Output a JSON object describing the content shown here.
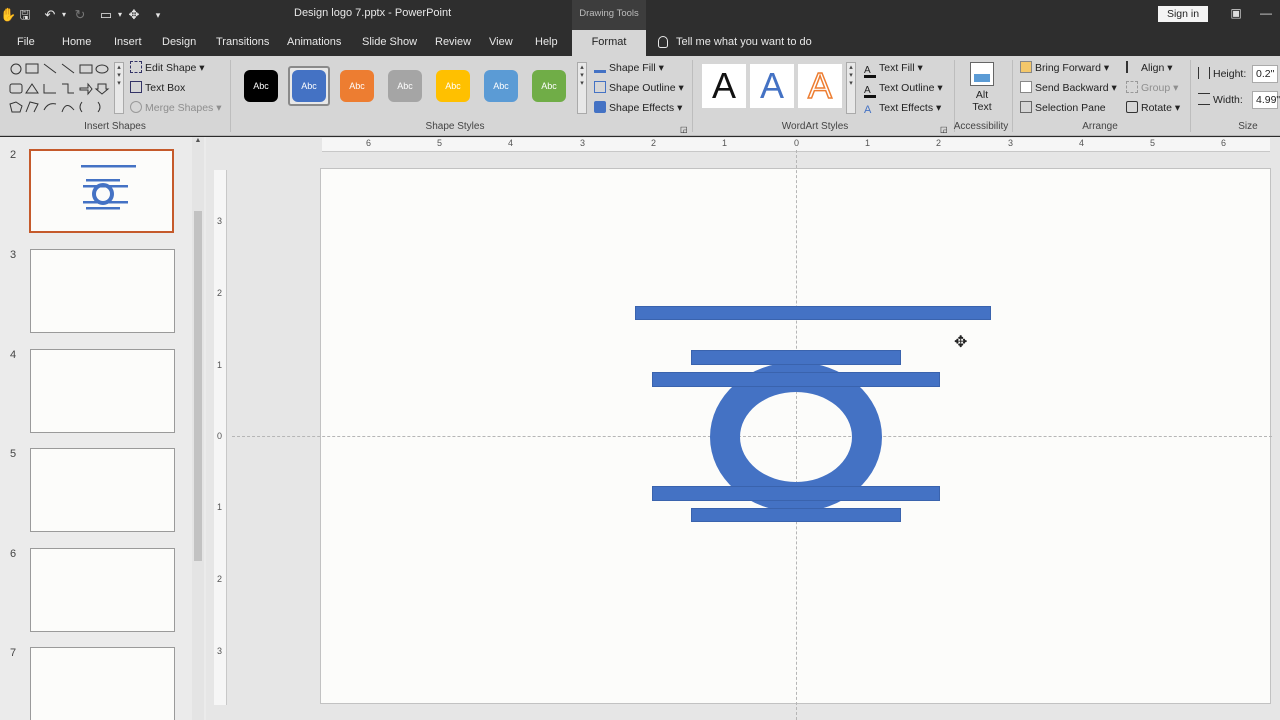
{
  "titlebar": {
    "doc_title": "Design logo 7.pptx  -  PowerPoint",
    "contextual_tab_group": "Drawing Tools",
    "sign_in": "Sign in"
  },
  "tabs": [
    {
      "label": "File"
    },
    {
      "label": "Home"
    },
    {
      "label": "Insert"
    },
    {
      "label": "Design"
    },
    {
      "label": "Transitions"
    },
    {
      "label": "Animations"
    },
    {
      "label": "Slide Show"
    },
    {
      "label": "Review"
    },
    {
      "label": "View"
    },
    {
      "label": "Help"
    },
    {
      "label": "Format"
    }
  ],
  "tell_me": "Tell me what you want to do",
  "ribbon": {
    "insert_shapes": {
      "label": "Insert Shapes",
      "edit_shape": "Edit Shape",
      "text_box": "Text Box",
      "merge_shapes": "Merge Shapes"
    },
    "shape_styles": {
      "label": "Shape Styles",
      "swatch_text": "Abc",
      "swatches": [
        {
          "color": "#000000"
        },
        {
          "color": "#4472c4"
        },
        {
          "color": "#ed7d31"
        },
        {
          "color": "#a5a5a5"
        },
        {
          "color": "#ffc000"
        },
        {
          "color": "#5b9bd5"
        },
        {
          "color": "#70ad47"
        }
      ],
      "shape_fill": "Shape Fill",
      "shape_outline": "Shape Outline",
      "shape_effects": "Shape Effects"
    },
    "wordart": {
      "label": "WordArt Styles",
      "letter": "A",
      "text_fill": "Text Fill",
      "text_outline": "Text Outline",
      "text_effects": "Text Effects"
    },
    "accessibility": {
      "label": "Accessibility",
      "alt_text_line1": "Alt",
      "alt_text_line2": "Text"
    },
    "arrange": {
      "label": "Arrange",
      "bring_forward": "Bring Forward",
      "send_backward": "Send Backward",
      "selection_pane": "Selection Pane",
      "align": "Align",
      "group": "Group",
      "rotate": "Rotate"
    },
    "size": {
      "label": "Size",
      "height_label": "Height:",
      "height_value": "0.2\"",
      "width_label": "Width:",
      "width_value": "4.99\""
    }
  },
  "slides": {
    "numbers": [
      "2",
      "3",
      "4",
      "5",
      "6",
      "7"
    ],
    "selected": "2"
  },
  "rulers": {
    "horizontal_ticks": [
      "6",
      "5",
      "4",
      "3",
      "2",
      "1",
      "0",
      "1",
      "2",
      "3",
      "4",
      "5",
      "6"
    ],
    "vertical_ticks": [
      "3",
      "2",
      "1",
      "0",
      "1",
      "2",
      "3"
    ]
  },
  "colors": {
    "shape_blue": "#4472c4",
    "selection_orange": "#c55a2b"
  }
}
